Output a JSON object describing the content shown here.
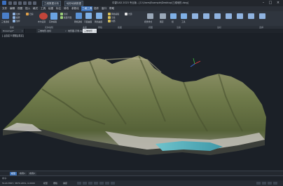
{
  "titlebar": {
    "tabs": [
      "三维数据分析",
      "地形地貌数据"
    ],
    "title": "中望CAD 2023 专业版 - [C:\\Users\\Example\\Desktop\\三维地形.dwg]"
  },
  "menubar": {
    "items": [
      "文件",
      "编辑",
      "视图",
      "插入",
      "格式",
      "工具",
      "绘图",
      "标注",
      "修改",
      "参数化",
      "三维工具",
      "插件",
      "窗口",
      "帮助"
    ],
    "active_index": 10
  },
  "ribbon": {
    "labels": [
      "三维建模",
      "拉伸",
      "旋转",
      "放样",
      "扫掠",
      "布尔运算",
      "实体编辑",
      "剖切",
      "截面平面",
      "网格建模",
      "平面曲面",
      "网络曲面",
      "网格编辑",
      "渲染",
      "材质",
      "光源",
      "视觉样式",
      "图层",
      "组",
      "工具"
    ]
  },
  "groups": [
    "建模",
    "实体编辑",
    "曲面",
    "网格",
    "截面",
    "视图",
    "渲染",
    "坐标",
    "选择"
  ],
  "doc_tabs": [
    {
      "label": "Drawing1*",
      "active": false
    },
    {
      "label": "三维地形-坐标",
      "active": false
    },
    {
      "label": "地形图-示例.dwg",
      "active": false
    },
    {
      "label": "三维地形",
      "active": true
    }
  ],
  "viewport": {
    "label": "[-][自定义视图][真实]"
  },
  "bottom_tabs": [
    {
      "label": "模型",
      "active": true
    },
    {
      "label": "布局1",
      "active": false
    },
    {
      "label": "布局2",
      "active": false
    }
  ],
  "command": {
    "prompt": "命令:"
  },
  "status": {
    "coords": "5124.3567, 3870.2451, 0.0000",
    "items": [
      "模型",
      "栅格",
      "捕捉"
    ]
  },
  "colors": {
    "accent": "#3a6fb6",
    "sea": "#4fa9b8",
    "terrain": "#7d8256"
  }
}
